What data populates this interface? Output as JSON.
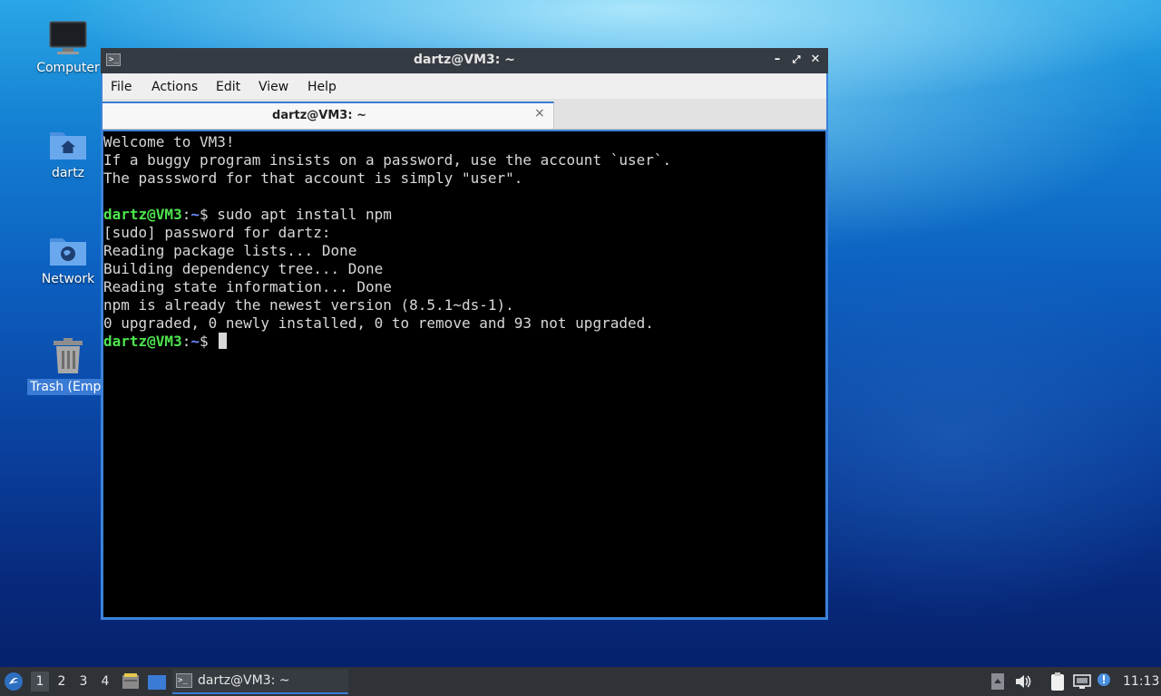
{
  "desktop": {
    "icons": [
      {
        "label": "Computer"
      },
      {
        "label": "dartz"
      },
      {
        "label": "Network"
      },
      {
        "label": "Trash (Empt"
      }
    ]
  },
  "window": {
    "title": "dartz@VM3: ~",
    "menu": [
      "File",
      "Actions",
      "Edit",
      "View",
      "Help"
    ],
    "tab_label": "dartz@VM3: ~",
    "tab_close": "×"
  },
  "terminal": {
    "lines": [
      "Welcome to VM3!",
      "If a buggy program insists on a password, use the account `user`.",
      "The passsword for that account is simply \"user\".",
      "",
      "",
      "[sudo] password for dartz:",
      "Reading package lists... Done",
      "Building dependency tree... Done",
      "Reading state information... Done",
      "npm is already the newest version (8.5.1~ds-1).",
      "0 upgraded, 0 newly installed, 0 to remove and 93 not upgraded."
    ],
    "prompt_user": "dartz@VM3",
    "prompt_sep": ":",
    "prompt_path": "~",
    "prompt_dollar": "$ ",
    "command1": "sudo apt install npm"
  },
  "taskbar": {
    "workspaces": [
      "1",
      "2",
      "3",
      "4"
    ],
    "task_label": "dartz@VM3: ~",
    "clock": "11:13"
  },
  "colors": {
    "accent": "#3a7bd5",
    "prompt_user": "#4ee44e",
    "prompt_path": "#6b8cff"
  }
}
